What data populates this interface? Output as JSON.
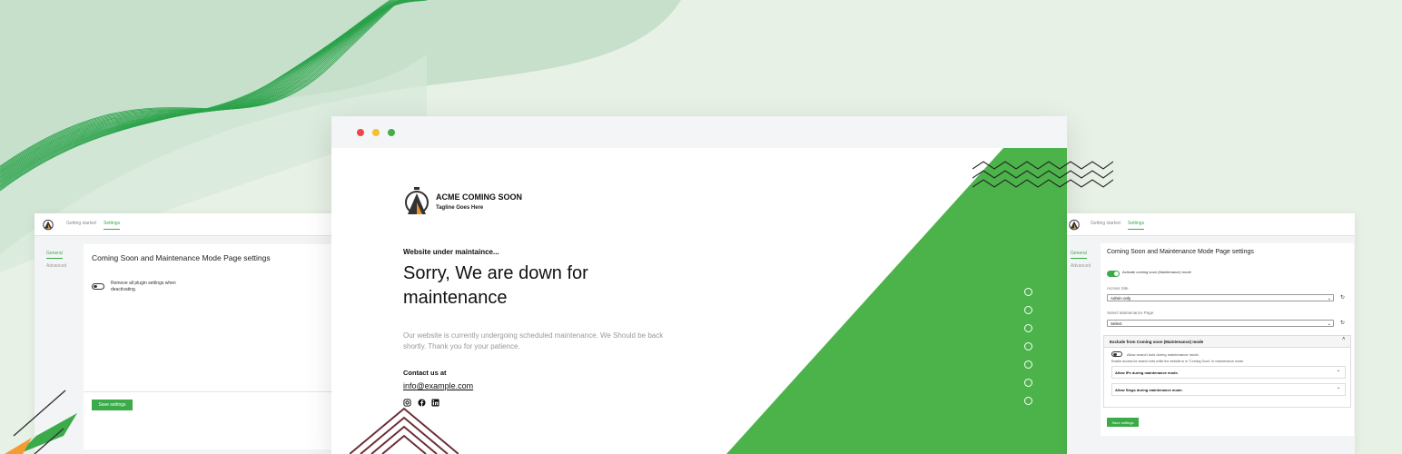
{
  "colors": {
    "accent": "#3bab4a",
    "background": "#e8f1e6",
    "dark_accent": "#6b2d36"
  },
  "left_panel": {
    "nav": [
      "Getting started",
      "Settings"
    ],
    "sidebar": [
      "General",
      "Advanced"
    ],
    "card_title": "Coming Soon and Maintenance Mode Page settings",
    "toggle_label": "Remove all plugin settings when deactivating.",
    "save_label": "Save settings"
  },
  "preview": {
    "brand": "ACME COMING SOON",
    "tagline": "Tagline Goes Here",
    "kicker": "Website under maintaince...",
    "headline": "Sorry, We are down for maintenance",
    "message": "Our website is currently undergoing scheduled maintenance. We Should be back shortly. Thank you for your patience.",
    "contact_heading": "Contact us at",
    "email": "info@example.com",
    "social_icons": [
      "instagram-icon",
      "facebook-icon",
      "linkedin-icon"
    ],
    "slide_dots": 7
  },
  "right_panel": {
    "nav": [
      "Getting started",
      "Settings"
    ],
    "sidebar": [
      "General",
      "Advanced"
    ],
    "card_title": "Coming Soon and Maintenance Mode Page settings",
    "activate_label": "Activate coming soon (Maintenance) mode",
    "access_label": "Access Site",
    "access_value": "Admin only",
    "page_label": "Select Maintenance Page",
    "page_value": "Select",
    "exclude_title": "Exclude from Coming soon (Maintenance) mode",
    "bots_label": "Allow search bots during maintenance mode.",
    "bots_help": "Enable access for search bots while the website is in \"Coming Soon\" or maintenance mode.",
    "ips_label": "Allow IPs during maintenance mode.",
    "slugs_label": "Allow Slugs during maintenance mode.",
    "save_label": "Save settings"
  }
}
